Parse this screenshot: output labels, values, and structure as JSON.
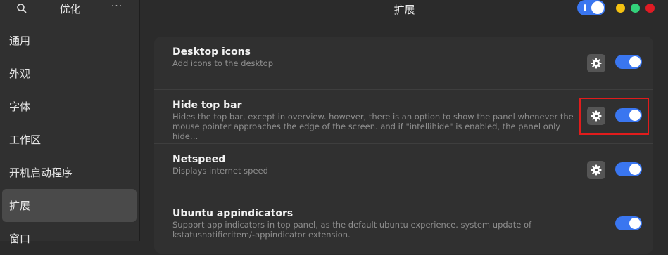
{
  "sidebar": {
    "title": "优化",
    "menu_label": "···",
    "items": [
      {
        "label": "通用"
      },
      {
        "label": "外观"
      },
      {
        "label": "字体"
      },
      {
        "label": "工作区"
      },
      {
        "label": "开机启动程序"
      },
      {
        "label": "扩展"
      },
      {
        "label": "窗口"
      }
    ],
    "selected_index": 5
  },
  "header": {
    "title": "扩展",
    "master_toggle_on": true,
    "window_buttons": [
      {
        "name": "minimize",
        "color": "#f5c211"
      },
      {
        "name": "maximize",
        "color": "#33d17a"
      },
      {
        "name": "close",
        "color": "#e01b24"
      }
    ]
  },
  "extensions": [
    {
      "name": "Desktop icons",
      "description": "Add icons to the desktop",
      "has_settings": true,
      "enabled": true
    },
    {
      "name": "Hide top bar",
      "description": "Hides the top bar, except in overview. however, there is an option to show the panel whenever the mouse pointer approaches the edge of the screen. and if \"intellihide\" is enabled, the panel only hide…",
      "has_settings": true,
      "enabled": true
    },
    {
      "name": "Netspeed",
      "description": "Displays internet speed",
      "has_settings": true,
      "enabled": true
    },
    {
      "name": "Ubuntu appindicators",
      "description": "Support app indicators in top panel, as the default ubuntu experience. system update of kstatusnotifieritem/-appindicator extension.",
      "has_settings": false,
      "enabled": true
    }
  ],
  "colors": {
    "accent": "#3a76f0",
    "highlight_box": "#e11c1c"
  }
}
